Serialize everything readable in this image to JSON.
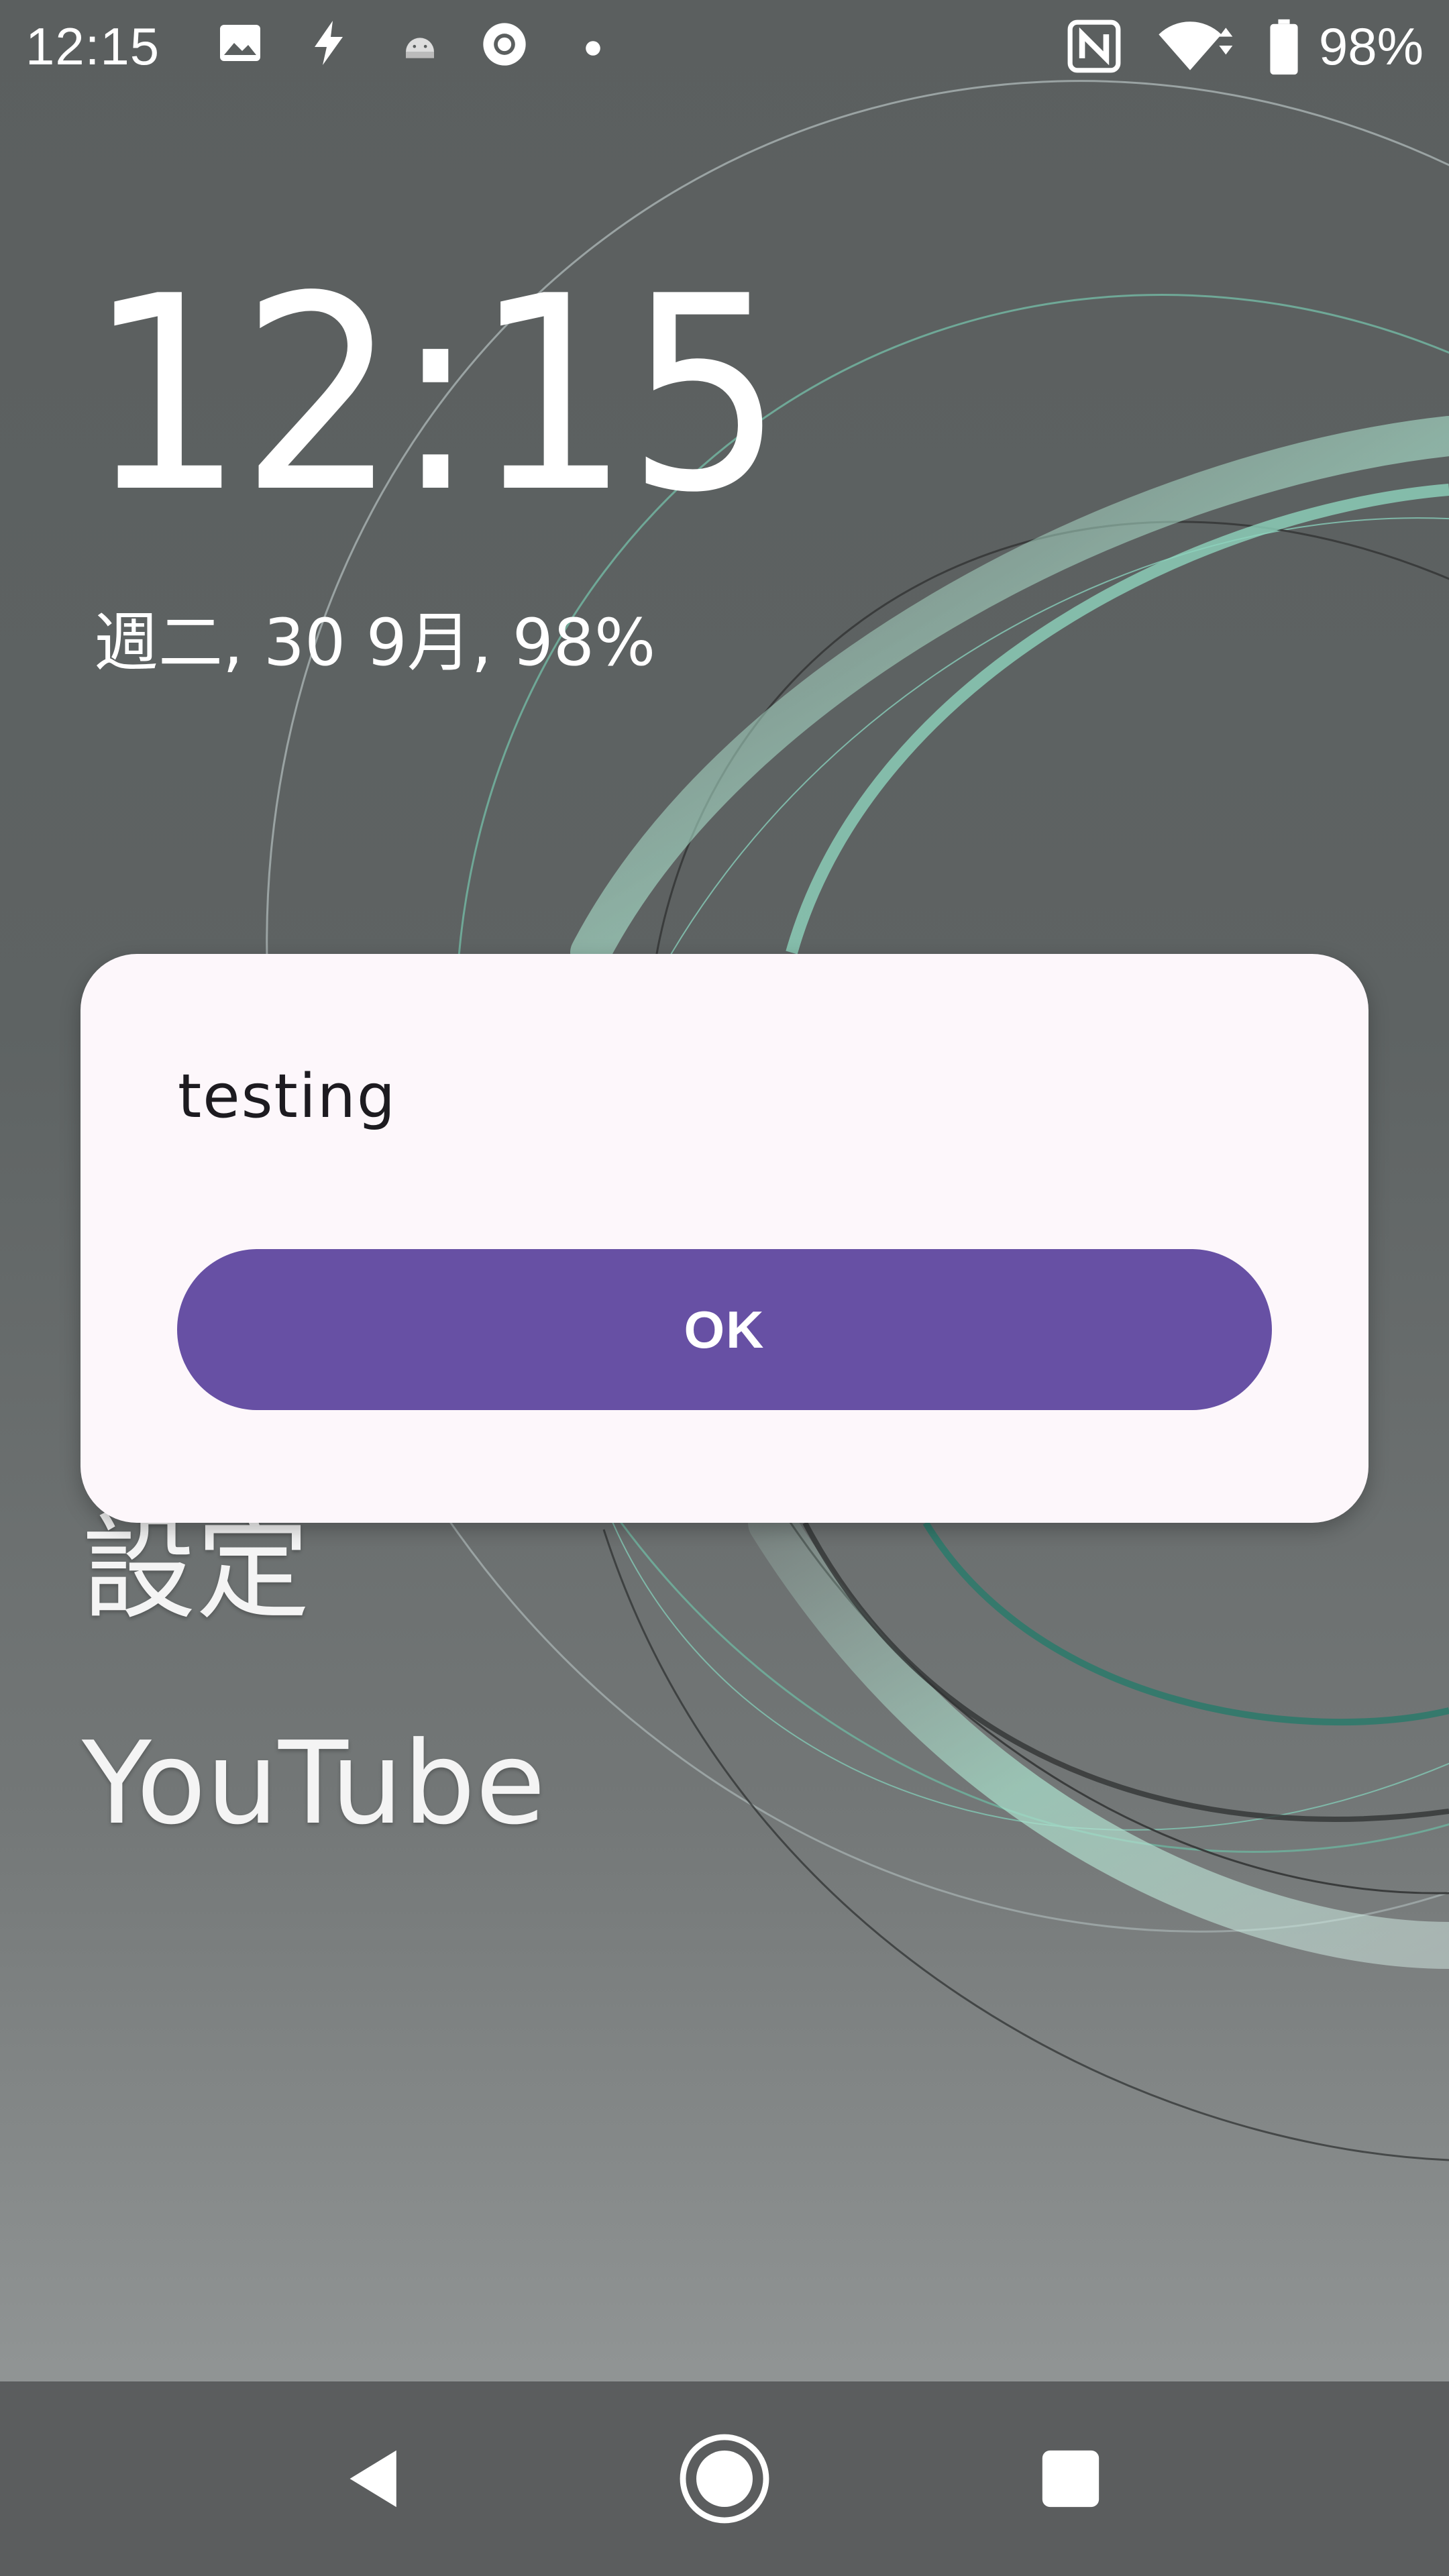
{
  "status_bar": {
    "time": "12:15",
    "left_icons": [
      "image-icon",
      "flash-icon",
      "android-icon",
      "chrome-icon",
      "dot-icon"
    ],
    "right_icons": [
      "nfc-icon",
      "wifi-icon",
      "battery-icon"
    ],
    "battery_percent": "98%"
  },
  "lockscreen": {
    "clock": "12:15",
    "date_line": "週二, 30 9月, 98%",
    "shortcuts": [
      "設定",
      "YouTube"
    ]
  },
  "dialog": {
    "message": "testing",
    "ok_label": "OK",
    "accent_color": "#6750a4",
    "background_color": "#fdf7fb"
  },
  "navigation_bar": {
    "buttons": [
      "back-icon",
      "home-icon",
      "recents-icon"
    ]
  }
}
